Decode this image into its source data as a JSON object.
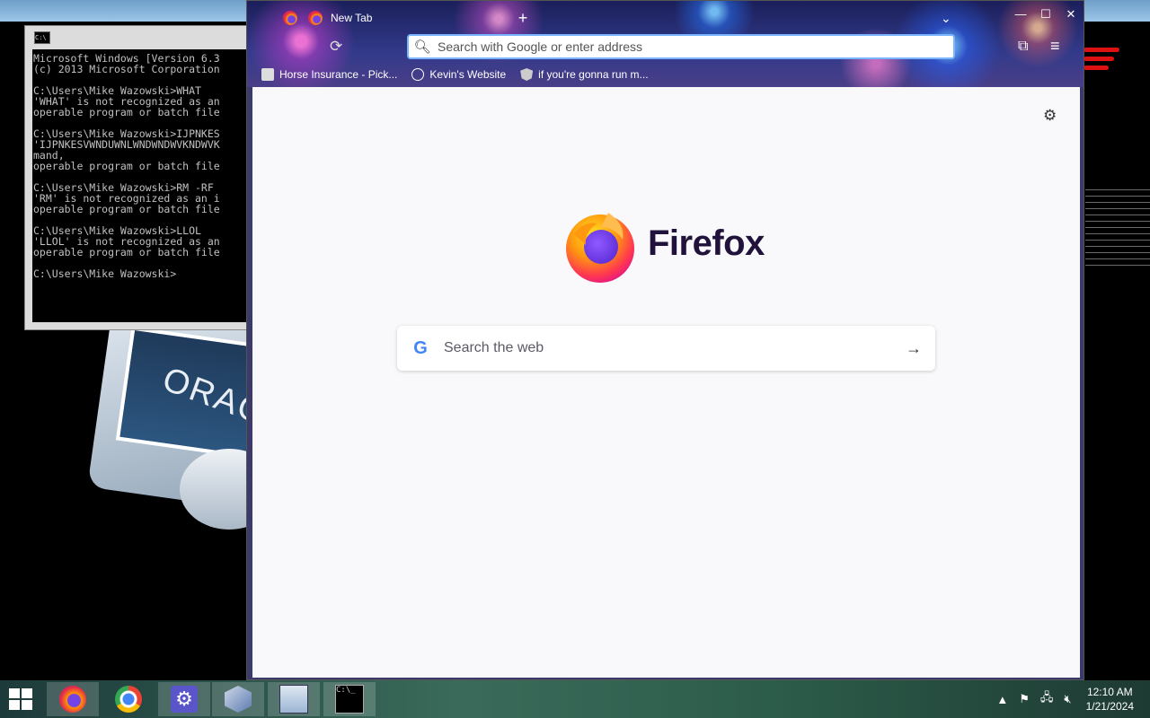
{
  "cmd": {
    "lines": [
      "Microsoft Windows [Version 6.3",
      "(c) 2013 Microsoft Corporation",
      "",
      "C:\\Users\\Mike Wazowski>WHAT",
      "'WHAT' is not recognized as an",
      "operable program or batch file",
      "",
      "C:\\Users\\Mike Wazowski>IJPNKES",
      "'IJPNKESVWNDUWNLWNDWNDWVKNDWVK",
      "mand,",
      "operable program or batch file",
      "",
      "C:\\Users\\Mike Wazowski>RM -RF",
      "'RM' is not recognized as an i",
      "operable program or batch file",
      "",
      "C:\\Users\\Mike Wazowski>LLOL",
      "'LLOL' is not recognized as an",
      "operable program or batch file",
      "",
      "C:\\Users\\Mike Wazowski>"
    ]
  },
  "desktop": {
    "oracle_text": "ORACL"
  },
  "firefox": {
    "tab_title": "New Tab",
    "url_placeholder": "Search with Google or enter address",
    "bookmarks": [
      {
        "label": "Horse Insurance - Pick..."
      },
      {
        "label": "Kevin's Website"
      },
      {
        "label": "if you're gonna run m..."
      }
    ],
    "brand": "Firefox",
    "search_placeholder": "Search the web",
    "google_letter": "G"
  },
  "taskbar": {
    "time": "12:10 AM",
    "date": "1/21/2024"
  },
  "icons": [
    "windows-start-icon",
    "firefox-icon",
    "chrome-icon",
    "settings-icon",
    "virtualbox-icon",
    "cmd-icon",
    "gear-icon",
    "search-icon",
    "reload-icon",
    "extensions-icon",
    "menu-icon",
    "arrow-right-icon",
    "flag-icon",
    "network-icon",
    "volume-muted-icon"
  ]
}
